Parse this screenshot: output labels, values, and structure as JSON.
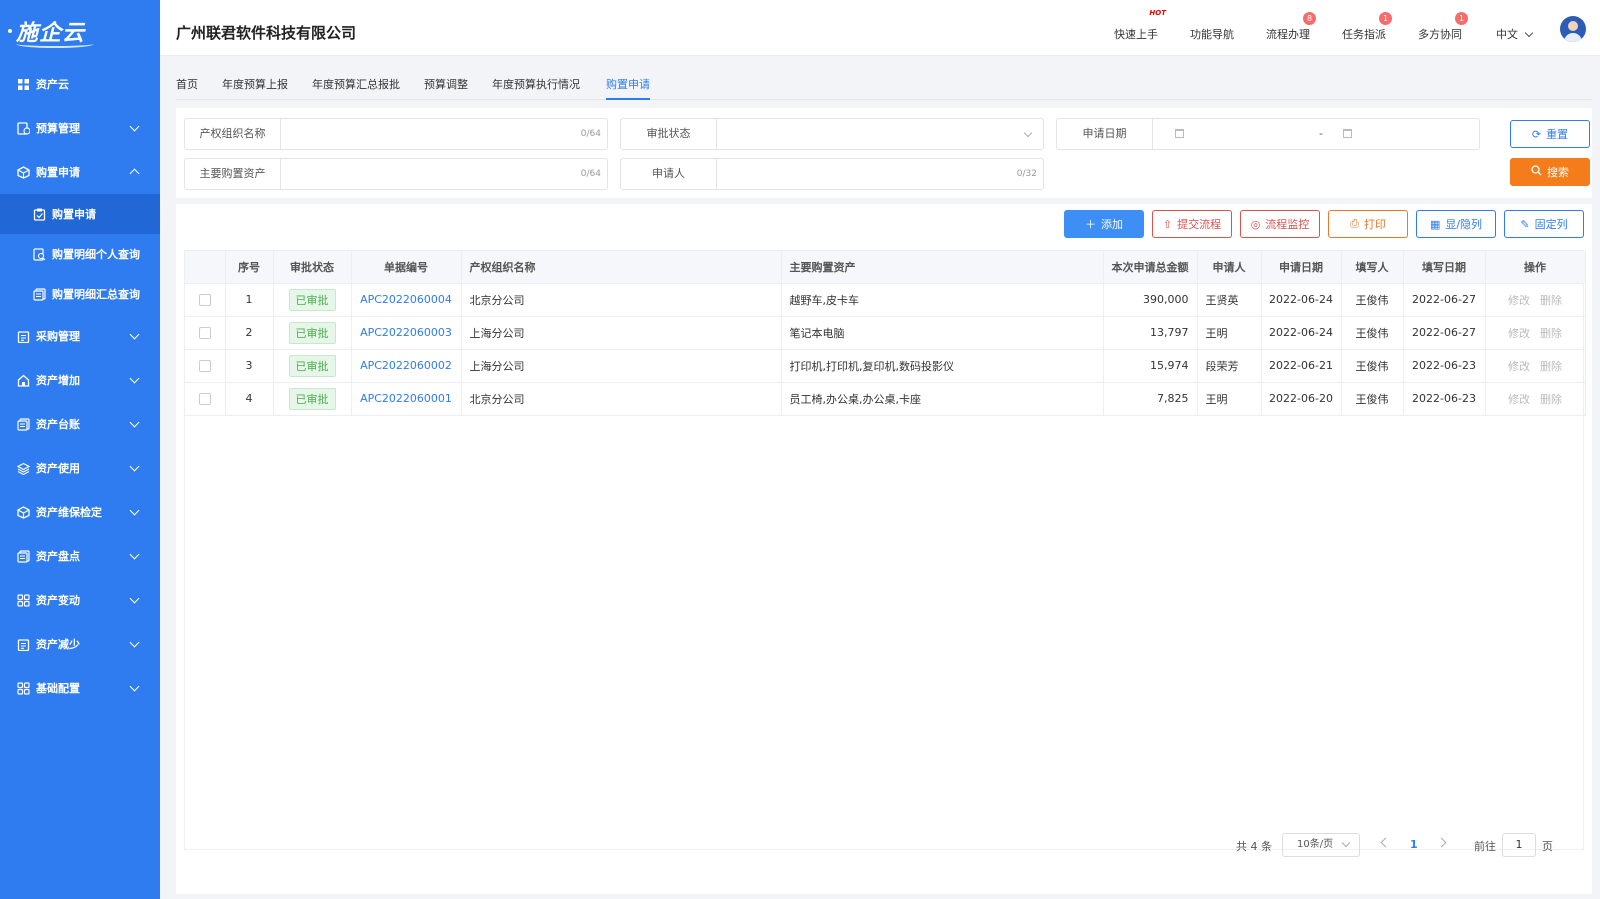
{
  "app": {
    "logo": "施企云",
    "company": "广州联君软件科技有限公司"
  },
  "header": {
    "nav": [
      {
        "label": "快速上手",
        "hot": "HOT"
      },
      {
        "label": "功能导航"
      },
      {
        "label": "流程办理",
        "badge": "8"
      },
      {
        "label": "任务指派",
        "badge": "1"
      },
      {
        "label": "多方协同",
        "badge": "1"
      }
    ],
    "language": "中文"
  },
  "sidebar": {
    "items": [
      {
        "label": "资产云",
        "icon": "grid-icon"
      },
      {
        "label": "预算管理",
        "icon": "budget-icon"
      },
      {
        "label": "购置申请",
        "icon": "box-icon",
        "expanded": true
      },
      {
        "label": "采购管理",
        "icon": "clipboard-icon"
      },
      {
        "label": "资产增加",
        "icon": "home-icon"
      },
      {
        "label": "资产台账",
        "icon": "ledger-icon"
      },
      {
        "label": "资产使用",
        "icon": "layers-icon"
      },
      {
        "label": "资产维保检定",
        "icon": "cube-icon"
      },
      {
        "label": "资产盘点",
        "icon": "stack-icon"
      },
      {
        "label": "资产变动",
        "icon": "apps-icon"
      },
      {
        "label": "资产减少",
        "icon": "doc-icon"
      },
      {
        "label": "基础配置",
        "icon": "settings-grid-icon"
      }
    ],
    "subitems": [
      {
        "label": "购置申请",
        "active": true
      },
      {
        "label": "购置明细个人查询"
      },
      {
        "label": "购置明细汇总查询"
      }
    ]
  },
  "tabs": [
    {
      "label": "首页"
    },
    {
      "label": "年度预算上报"
    },
    {
      "label": "年度预算汇总报批"
    },
    {
      "label": "预算调整"
    },
    {
      "label": "年度预算执行情况"
    },
    {
      "label": "购置申请",
      "active": true
    }
  ],
  "filter": {
    "org_label": "产权组织名称",
    "org_count": "0/64",
    "status_label": "审批状态",
    "date_label": "申请日期",
    "date_sep": "-",
    "asset_label": "主要购置资产",
    "asset_count": "0/64",
    "applicant_label": "申请人",
    "applicant_count": "0/32",
    "reset": "重置",
    "search": "搜索"
  },
  "toolbar": {
    "add": "添加",
    "submit": "提交流程",
    "monitor": "流程监控",
    "print": "打印",
    "toggle_cols": "显/隐列",
    "fix_cols": "固定列"
  },
  "table": {
    "headers": [
      "",
      "序号",
      "审批状态",
      "单据编号",
      "产权组织名称",
      "主要购置资产",
      "本次申请总金额",
      "申请人",
      "申请日期",
      "填写人",
      "填写日期",
      "操作"
    ],
    "edit": "修改",
    "delete": "删除",
    "rows": [
      {
        "no": "1",
        "status": "已审批",
        "code": "APC2022060004",
        "org": "北京分公司",
        "assets": "越野车,皮卡车",
        "amount": "390,000",
        "applicant": "王贤英",
        "apply_date": "2022-06-24",
        "filler": "王俊伟",
        "fill_date": "2022-06-27"
      },
      {
        "no": "2",
        "status": "已审批",
        "code": "APC2022060003",
        "org": "上海分公司",
        "assets": "笔记本电脑",
        "amount": "13,797",
        "applicant": "王明",
        "apply_date": "2022-06-24",
        "filler": "王俊伟",
        "fill_date": "2022-06-27"
      },
      {
        "no": "3",
        "status": "已审批",
        "code": "APC2022060002",
        "org": "上海分公司",
        "assets": "打印机,打印机,复印机,数码投影仪",
        "amount": "15,974",
        "applicant": "段荣芳",
        "apply_date": "2022-06-21",
        "filler": "王俊伟",
        "fill_date": "2022-06-23"
      },
      {
        "no": "4",
        "status": "已审批",
        "code": "APC2022060001",
        "org": "北京分公司",
        "assets": "员工椅,办公桌,办公桌,卡座",
        "amount": "7,825",
        "applicant": "王明",
        "apply_date": "2022-06-20",
        "filler": "王俊伟",
        "fill_date": "2022-06-23"
      }
    ]
  },
  "pagination": {
    "total": "共 4 条",
    "page_size": "10条/页",
    "current": "1",
    "goto_prefix": "前往",
    "goto_value": "1",
    "goto_suffix": "页"
  },
  "colors": {
    "sidebar": "#2f7cf0",
    "primary": "#2f7cf0",
    "search": "#f47c1b",
    "approved": "#4caf50"
  }
}
